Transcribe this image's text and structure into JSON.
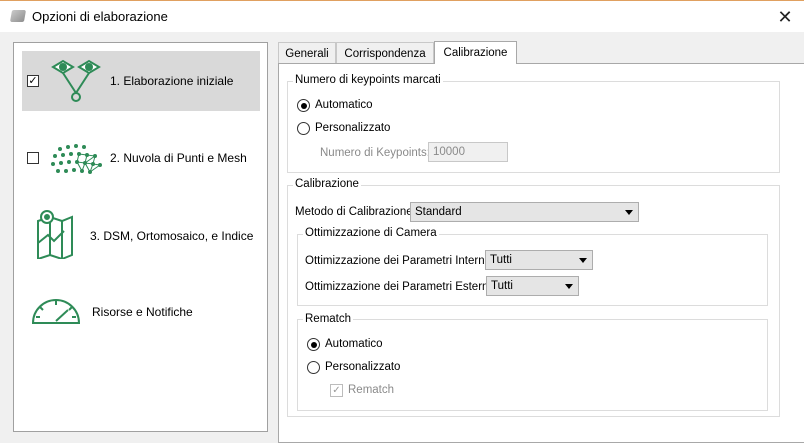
{
  "window": {
    "title": "Opzioni di elaborazione",
    "close_glyph": "✕",
    "icon": "app-icon"
  },
  "steps": [
    {
      "label": "1. Elaborazione iniziale",
      "checked": true,
      "icon": "keypoints-icon",
      "check_glyph": "✓"
    },
    {
      "label": "2. Nuvola di Punti e Mesh",
      "checked": false,
      "icon": "point-cloud-icon"
    },
    {
      "label": "3. DSM, Ortomosaico, e Indice",
      "icon": "map-icon"
    },
    {
      "label": "Risorse e Notifiche",
      "icon": "gauge-icon"
    }
  ],
  "tabs": [
    "Generali",
    "Corrispondenza",
    "Calibrazione"
  ],
  "active_tab": "Calibrazione",
  "keypoints": {
    "title": "Numero di keypoints marcati",
    "options": [
      "Automatico",
      "Personalizzato"
    ],
    "selected": "Automatico",
    "count_label": "Numero di Keypoints:",
    "count_value": "10000"
  },
  "calibration": {
    "title": "Calibrazione",
    "method_label": "Metodo di Calibrazione",
    "method_value": "Standard",
    "camera": {
      "title": "Ottimizzazione di Camera",
      "internal_label": "Ottimizzazione dei Parametri Interni:",
      "internal_value": "Tutti",
      "external_label": "Ottimizzazione dei Parametri Esterni:",
      "external_value": "Tutti"
    },
    "rematch": {
      "title": "Rematch",
      "options": [
        "Automatico",
        "Personalizzato"
      ],
      "selected": "Automatico",
      "checkbox_label": "Rematch",
      "checkbox_checked": true,
      "check_glyph": "✓"
    }
  },
  "colors": {
    "accent_green": "#2e8b57",
    "selection": "#d9d9d9"
  }
}
